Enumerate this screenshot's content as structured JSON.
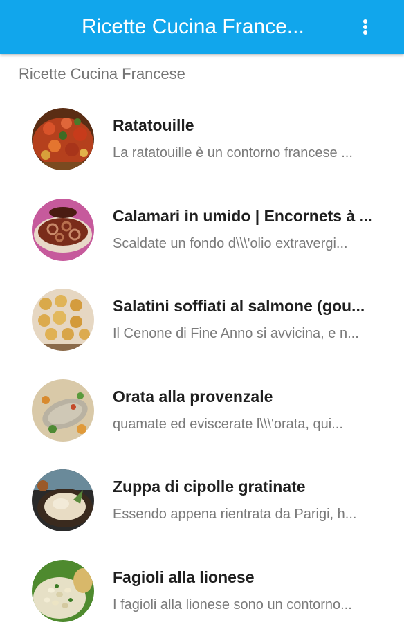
{
  "app_bar": {
    "title": "Ricette Cucina France...",
    "overflow_icon": "more-vert-icon",
    "color": "#11a6ec"
  },
  "section": {
    "header": "Ricette Cucina Francese"
  },
  "recipes": [
    {
      "title": "Ratatouille",
      "subtitle": "La ratatouille è un contorno francese ...",
      "image_icon": "ratatouille-thumbnail"
    },
    {
      "title": "Calamari in umido | Encornets à ...",
      "subtitle": "Scaldate un fondo d\\\\\\'olio extravergi...",
      "image_icon": "calamari-thumbnail"
    },
    {
      "title": "Salatini soffiati al salmone (gou...",
      "subtitle": "Il Cenone di Fine Anno si avvicina, e n...",
      "image_icon": "salatini-thumbnail"
    },
    {
      "title": "Orata alla provenzale",
      "subtitle": "quamate ed eviscerate l\\\\\\'orata, qui...",
      "image_icon": "orata-thumbnail"
    },
    {
      "title": "Zuppa di cipolle gratinate",
      "subtitle": "Essendo appena rientrata da Parigi, h...",
      "image_icon": "zuppa-thumbnail"
    },
    {
      "title": "Fagioli alla lionese",
      "subtitle": "I fagioli alla lionese sono un contorno...",
      "image_icon": "fagioli-thumbnail"
    }
  ]
}
